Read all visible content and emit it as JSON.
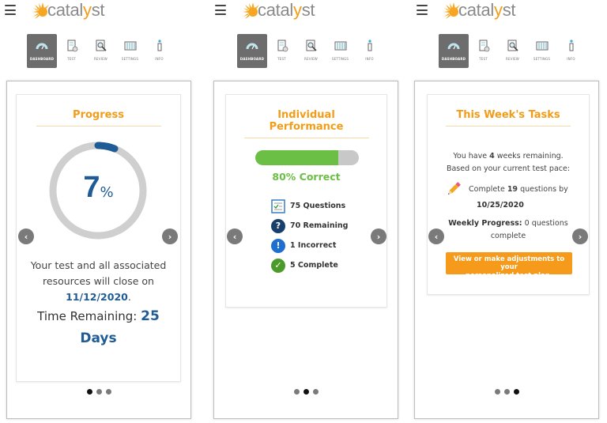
{
  "app": {
    "brand": "catalyst",
    "brand_prefix": "catal",
    "brand_y": "y",
    "brand_suffix": "st",
    "colors": {
      "accent_orange": "#f29d1a",
      "primary_blue": "#1f5c96",
      "success_green": "#6bbf44",
      "track_gray": "#c8c8c8",
      "nav_active": "#6d6d6d"
    }
  },
  "nav": {
    "items": [
      {
        "label": "DASHBOARD",
        "icon": "gauge-icon",
        "active": true
      },
      {
        "label": "TEST",
        "icon": "test-sheet-icon",
        "active": false
      },
      {
        "label": "REVIEW",
        "icon": "magnifier-icon",
        "active": false
      },
      {
        "label": "SETTINGS",
        "icon": "sliders-icon",
        "active": false
      },
      {
        "label": "INFO",
        "icon": "info-icon",
        "active": false
      }
    ]
  },
  "carousel": {
    "prev_icon": "chevron-left-icon",
    "next_icon": "chevron-right-icon",
    "slide_count": 3
  },
  "screens": [
    {
      "active_slide": 1,
      "card": {
        "title": "Progress",
        "progress_percent": 7,
        "progress_value": "7",
        "progress_symbol": "%",
        "close_text_line1": "Your test and all associated",
        "close_text_line2": "resources will close on",
        "close_date": "11/12/2020",
        "close_period": ".",
        "time_remaining_label": "Time Remaining:",
        "time_remaining_value": "25",
        "time_remaining_unit": "Days"
      }
    },
    {
      "active_slide": 2,
      "card": {
        "title_line1": "Individual",
        "title_line2": "Performance",
        "correct_percent": 80,
        "correct_label": "80% Correct",
        "stats": [
          {
            "icon": "checklist-icon",
            "label": "75 Questions"
          },
          {
            "icon": "question-icon",
            "label": "70 Remaining",
            "color": "#163f6b"
          },
          {
            "icon": "exclamation-icon",
            "label": "1 Incorrect",
            "color": "#1e6fd1"
          },
          {
            "icon": "check-circle-icon",
            "label": "5 Complete",
            "color": "#4c9a2a"
          }
        ]
      }
    },
    {
      "active_slide": 3,
      "card": {
        "title": "This Week's Tasks",
        "intro_pre": "You have ",
        "weeks": "4",
        "intro_post": " weeks remaining.",
        "intro_line2": "Based on your current test pace:",
        "task_pre": "Complete ",
        "task_count": "19",
        "task_post": " questions by",
        "task_date": "10/25/2020",
        "weekly_label": "Weekly Progress:",
        "weekly_value": " 0 questions",
        "weekly_line2": "complete",
        "cta_line1": "View or make adjustments to your",
        "cta_line2": "personalized test plan."
      }
    }
  ]
}
